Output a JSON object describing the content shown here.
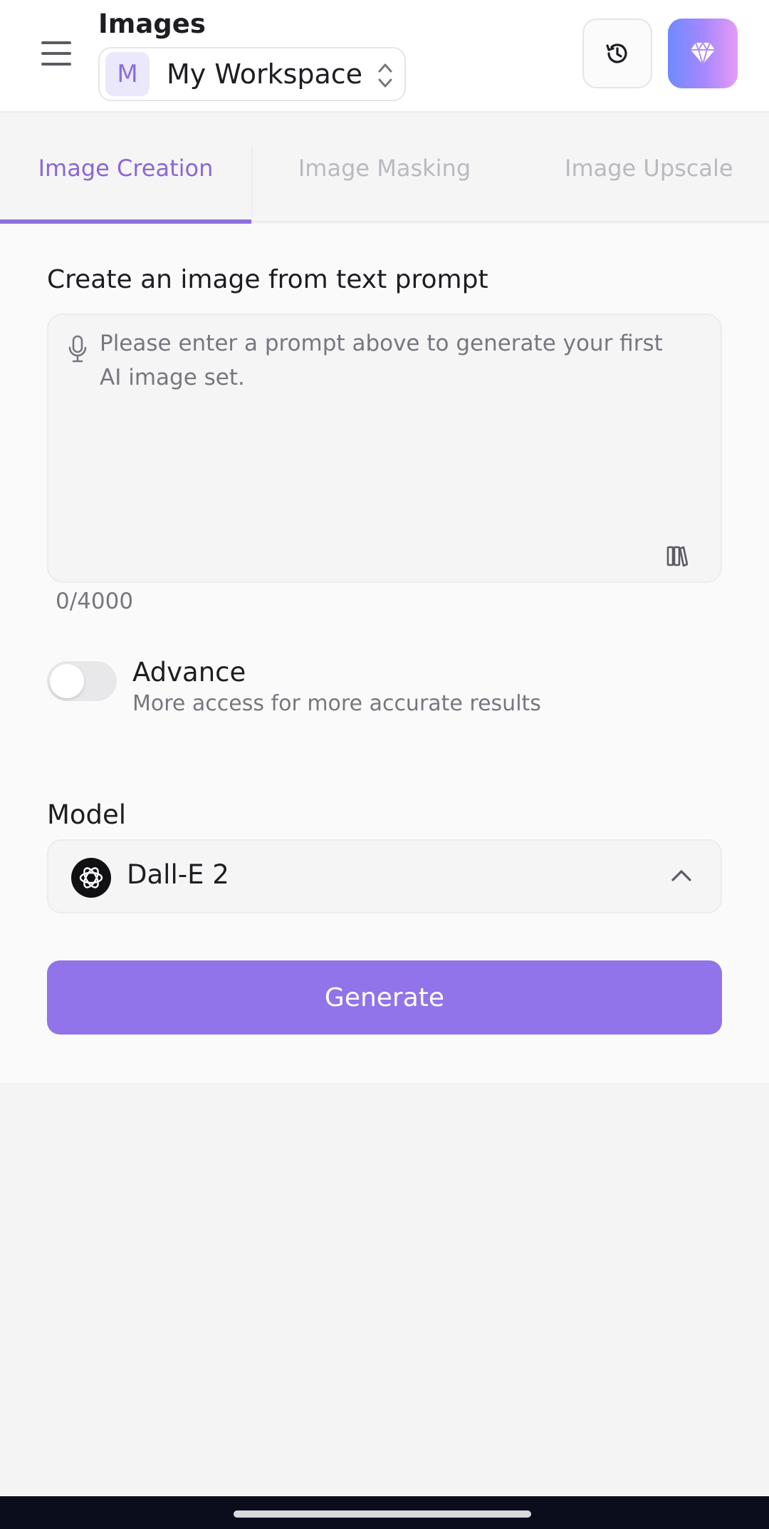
{
  "header": {
    "title": "Images",
    "workspace": {
      "avatar_letter": "M",
      "name": "My Workspace"
    }
  },
  "tabs": [
    {
      "label": "Image Creation",
      "active": true
    },
    {
      "label": "Image Masking",
      "active": false
    },
    {
      "label": "Image Upscale",
      "active": false
    }
  ],
  "prompt": {
    "section_title": "Create an image from text prompt",
    "placeholder": "Please enter a prompt above to generate your first AI image set.",
    "value": "",
    "char_count": "0/4000"
  },
  "advance": {
    "label": "Advance",
    "description": "More access for more accurate results",
    "enabled": false
  },
  "model": {
    "label": "Model",
    "selected": "Dall-E 2"
  },
  "generate_label": "Generate",
  "colors": {
    "accent": "#9173ea",
    "active_tab": "#8a67d6",
    "premium_gradient": [
      "#6f8bff",
      "#e59cf3"
    ]
  },
  "icons": {
    "menu": "hamburger-menu-icon",
    "workspace_switch": "chevron-up-down-icon",
    "history": "history-icon",
    "premium": "diamond-icon",
    "mic": "microphone-icon",
    "library": "prompt-library-icon",
    "model_logo": "openai-logo-icon",
    "model_chevron": "chevron-up-icon"
  }
}
